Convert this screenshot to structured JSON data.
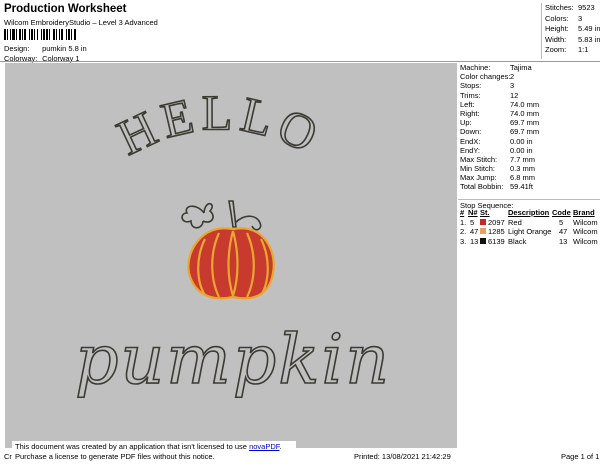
{
  "header": {
    "title": "Production Worksheet",
    "subtitle": "Wilcom EmbroideryStudio – Level 3 Advanced",
    "design_label": "Design:",
    "design_value": "pumkin 5.8 in",
    "colorway_label": "Colorway:",
    "colorway_value": "Colorway 1"
  },
  "stats": [
    {
      "label": "Stitches:",
      "value": "9523"
    },
    {
      "label": "Colors:",
      "value": "3"
    },
    {
      "label": "Height:",
      "value": "5.49 in"
    },
    {
      "label": "Width:",
      "value": "5.83 in"
    },
    {
      "label": "Zoom:",
      "value": "1:1"
    }
  ],
  "design": {
    "top_text": "HELLO",
    "bottom_text": "pumpkin",
    "thread_color": "#3b3a33",
    "pumpkin_fill": "#c8392e",
    "pumpkin_outline": "#e8a830"
  },
  "info": [
    {
      "label": "Machine:",
      "value": "Tajima"
    },
    {
      "label": "Color changes:",
      "value": "2"
    },
    {
      "label": "Stops:",
      "value": "3"
    },
    {
      "label": "Trims:",
      "value": "12"
    },
    {
      "label": "Left:",
      "value": "74.0 mm"
    },
    {
      "label": "Right:",
      "value": "74.0 mm"
    },
    {
      "label": "Up:",
      "value": "69.7 mm"
    },
    {
      "label": "Down:",
      "value": "69.7 mm"
    },
    {
      "label": "EndX:",
      "value": "0.00 in"
    },
    {
      "label": "EndY:",
      "value": "0.00 in"
    },
    {
      "label": "Max Stitch:",
      "value": "7.7 mm"
    },
    {
      "label": "Min Stitch:",
      "value": "0.3 mm"
    },
    {
      "label": "Max Jump:",
      "value": "6.8 mm"
    },
    {
      "label": "Total Bobbin:",
      "value": "59.41ft"
    }
  ],
  "stop_sequence": {
    "title": "Stop Sequence:",
    "headers": [
      "#",
      "N#",
      "St.",
      "Description",
      "Code",
      "Brand"
    ],
    "rows": [
      {
        "num": "1.",
        "n": "5",
        "st": "2097",
        "desc": "Red",
        "code": "5",
        "brand": "Wilcom",
        "color": "#c62828"
      },
      {
        "num": "2.",
        "n": "47",
        "st": "1285",
        "desc": "Light Orange",
        "code": "47",
        "brand": "Wilcom",
        "color": "#e8a060"
      },
      {
        "num": "3.",
        "n": "13",
        "st": "6139",
        "desc": "Black",
        "code": "13",
        "brand": "Wilcom",
        "color": "#111111"
      }
    ]
  },
  "notice": {
    "line1_pre": "This document was created by an application that isn't licensed to use ",
    "line1_link": "novaPDF",
    "line1_post": ".",
    "line2": "Purchase a license to generate PDF files without this notice."
  },
  "footer": {
    "left": "Cr",
    "printed": "Printed: 13/08/2021 21:42:29",
    "page": "Page 1 of 1"
  }
}
